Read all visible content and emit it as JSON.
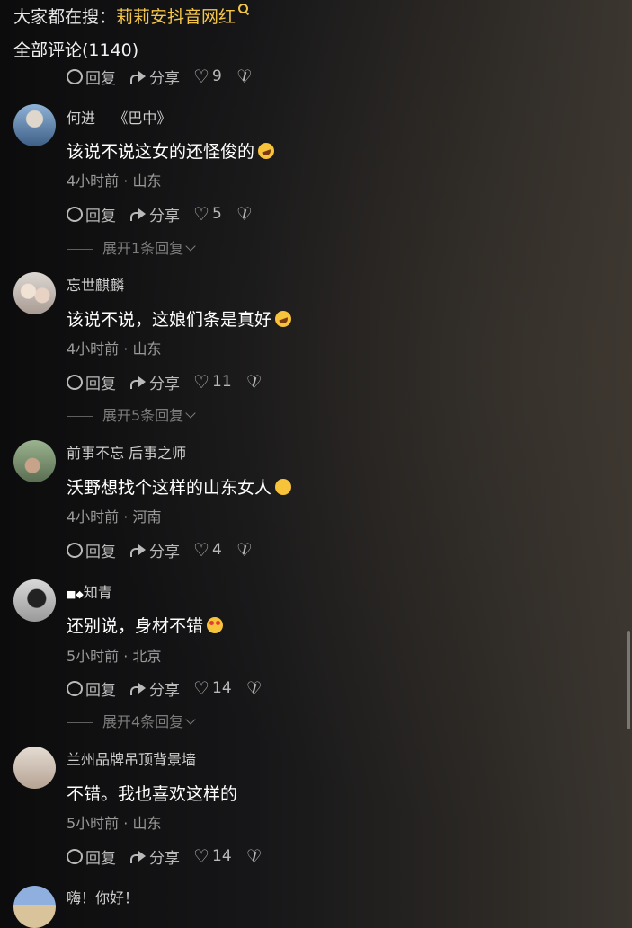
{
  "header": {
    "hot_search_prefix": "大家都在搜：",
    "hot_search_keyword": "莉莉安抖音网红",
    "comment_count": "全部评论(1140)"
  },
  "labels": {
    "reply": "回复",
    "share": "分享"
  },
  "partial_comment": {
    "likes": "9"
  },
  "comments": [
    {
      "user": "何进    《巴中》",
      "text": "该说不说这女的还怪俊的",
      "emoji": "laugh-tears",
      "meta": "4小时前 · 山东",
      "likes": "5",
      "expand": "展开1条回复"
    },
    {
      "user": "忘世麒麟",
      "text": "该说不说，这娘们条是真好",
      "emoji": "laugh-tears",
      "meta": "4小时前 · 山东",
      "likes": "11",
      "expand": "展开5条回复"
    },
    {
      "user": "前事不忘 后事之师",
      "text": "沃野想找个这样的山东女人",
      "emoji": "smirk",
      "meta": "4小时前 · 河南",
      "likes": "4"
    },
    {
      "user": "知青",
      "text": "还别说，身材不错",
      "emoji": "heart-eyes",
      "meta": "5小时前 · 北京",
      "likes": "14",
      "expand": "展开4条回复"
    },
    {
      "user": "兰州品牌吊顶背景墙",
      "text": "不错。我也喜欢这样的",
      "meta": "5小时前 · 山东",
      "likes": "14"
    },
    {
      "user": "嗨！你好！"
    }
  ]
}
